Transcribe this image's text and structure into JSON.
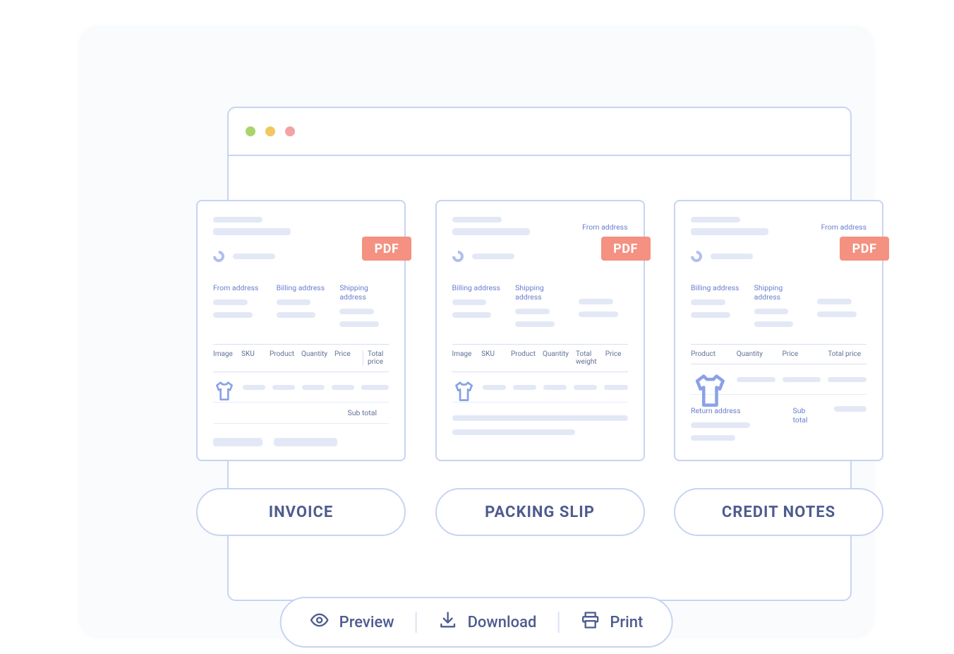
{
  "colors": {
    "border": "#c7d4f2",
    "text": "#4e5c8e",
    "placeholder": "#e3e8f6",
    "badge": "#f49181"
  },
  "pdf_badge": "PDF",
  "cards": [
    {
      "key": "invoice",
      "addresses": [
        "From address",
        "Billing address",
        "Shipping address"
      ],
      "columns": [
        "Image",
        "SKU",
        "Product",
        "Quantity",
        "Price",
        "Total price"
      ],
      "subtotal_label": "Sub total",
      "pill_label": "INVOICE"
    },
    {
      "key": "packing_slip",
      "top_from": "From address",
      "addresses": [
        "Billing address",
        "Shipping address"
      ],
      "columns": [
        "Image",
        "SKU",
        "Product",
        "Quantity",
        "Total weight",
        "Price"
      ],
      "pill_label": "PACKING SLIP"
    },
    {
      "key": "credit_notes",
      "top_from": "From address",
      "addresses": [
        "Billing address",
        "Shipping address"
      ],
      "columns": [
        "Product",
        "Quantity",
        "Price",
        "Total price"
      ],
      "return_label": "Return address",
      "subtotal_label": "Sub total",
      "pill_label": "CREDIT NOTES"
    }
  ],
  "actions": {
    "preview": "Preview",
    "download": "Download",
    "print": "Print"
  }
}
